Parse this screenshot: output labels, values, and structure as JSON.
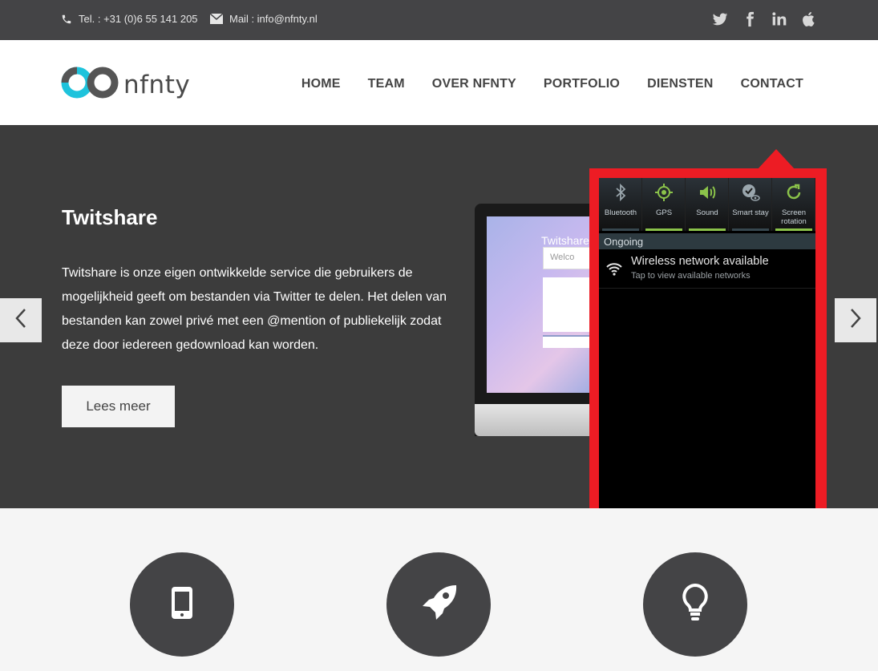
{
  "topbar": {
    "phone": "Tel. : +31 (0)6 55 141 205",
    "mail": "Mail : info@nfnty.nl",
    "social": [
      "twitter-icon",
      "facebook-icon",
      "linkedin-icon",
      "apple-icon"
    ]
  },
  "header": {
    "logo_text": "nfnty",
    "nav": [
      "HOME",
      "TEAM",
      "OVER NFNTY",
      "PORTFOLIO",
      "DIENSTEN",
      "CONTACT"
    ]
  },
  "hero": {
    "title": "Twitshare",
    "text": "Twitshare is onze eigen ontwikkelde service die gebruikers de mogelijkheid geeft om bestanden via Twitter te delen. Het delen van bestanden kan zowel privé met een @mention of publiekelijk zodat deze door iedereen gedownload kan worden.",
    "button": "Lees meer",
    "screen_title": "Twitshare",
    "screen_card": "Welco"
  },
  "panel": {
    "quick": [
      {
        "label": "Bluetooth",
        "icon": "bluetooth-icon",
        "on": false
      },
      {
        "label": "GPS",
        "icon": "gps-icon",
        "on": true
      },
      {
        "label": "Sound",
        "icon": "sound-icon",
        "on": true
      },
      {
        "label": "Smart stay",
        "icon": "smart-stay-icon",
        "on": false
      },
      {
        "label": "Screen rotation",
        "icon": "rotation-icon",
        "on": true
      }
    ],
    "ongoing": "Ongoing",
    "notif_title": "Wireless network available",
    "notif_sub": "Tap to view available networks"
  },
  "features": [
    "phone-icon",
    "rocket-icon",
    "lightbulb-icon"
  ],
  "colors": {
    "accent": "#1ec3dc",
    "highlight": "#ed1c24",
    "toggle_on": "#8bc34a",
    "dark": "#444446"
  }
}
